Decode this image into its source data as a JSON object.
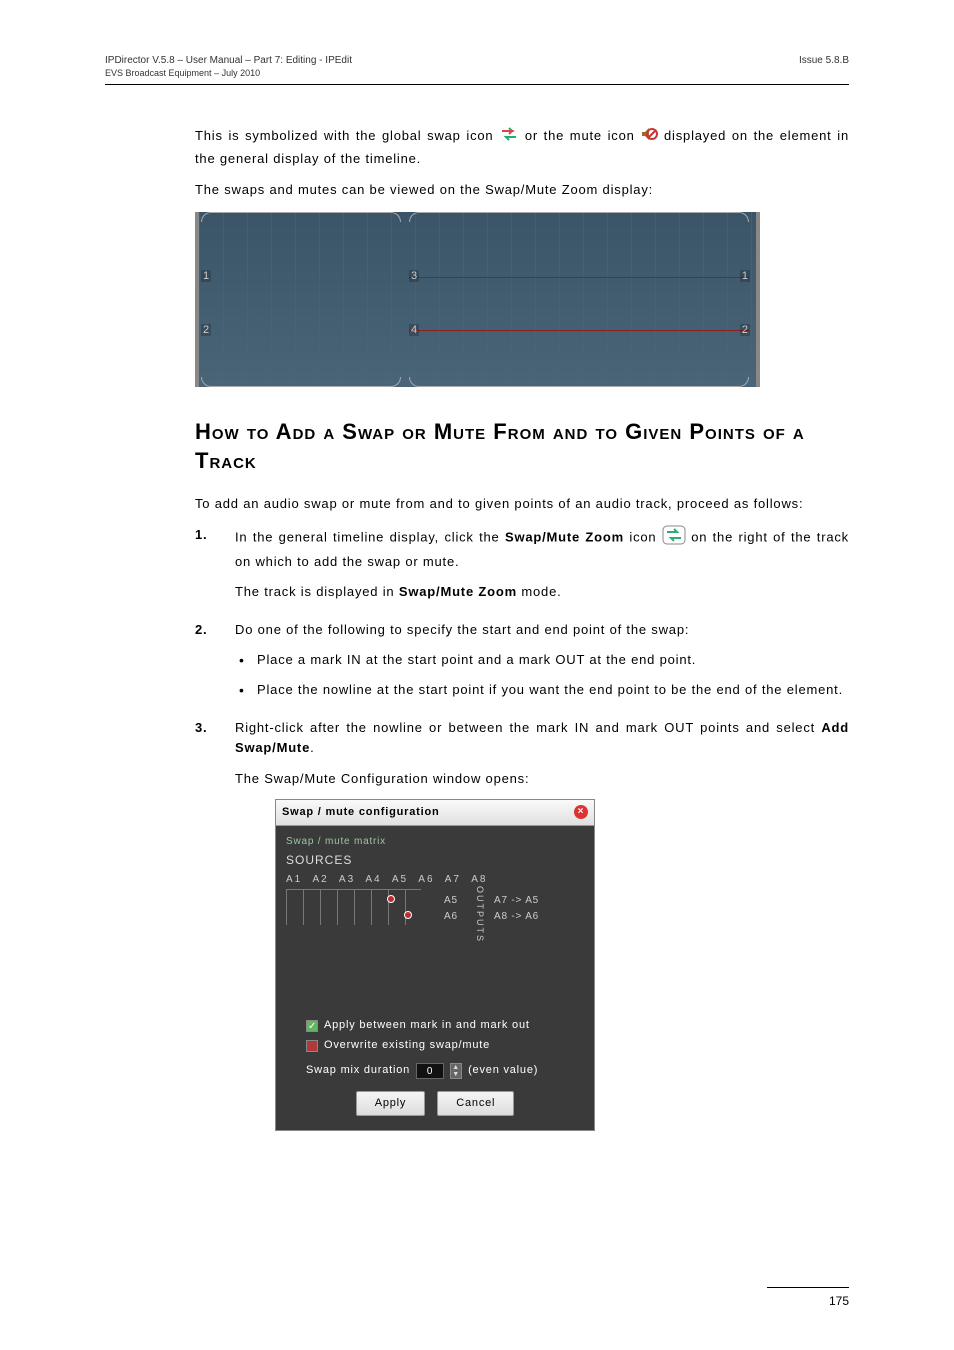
{
  "header": {
    "left": "IPDirector V.5.8 – User Manual – Part 7: Editing - IPEdit",
    "right": "Issue 5.8.B",
    "sub": "EVS Broadcast Equipment – July 2010"
  },
  "intro": {
    "line1_a": "This is symbolized with the global swap icon ",
    "line1_b": " or the mute icon ",
    "line1_c": " displayed on the element in the general display of the timeline.",
    "line2": "The swaps and mutes can be viewed on the Swap/Mute Zoom display:"
  },
  "timeline_labels": {
    "n1": "1",
    "n2": "2",
    "n3": "3",
    "n4": "4"
  },
  "section_title": "How to Add a Swap or Mute From and to Given Points of a Track",
  "para_after_title": "To add an audio swap or mute from and to given points of an audio track, proceed as follows:",
  "steps": {
    "s1_a": "In the general timeline display, click the ",
    "s1_bold": "Swap/Mute Zoom",
    "s1_b": " icon ",
    "s1_c": " on the right of the track on which to add the swap or mute.",
    "s1_sub_a": "The track is displayed in ",
    "s1_sub_bold": "Swap/Mute Zoom",
    "s1_sub_b": " mode.",
    "s2": "Do one of the following to specify the start and end point of the swap:",
    "s2_b1": "Place a mark IN at the start point and a mark OUT at the end point.",
    "s2_b2": "Place the nowline at the start point if you want the end point to be the end of the element.",
    "s3_a": "Right-click after the nowline or between the mark IN and mark OUT points and select ",
    "s3_bold": "Add Swap/Mute",
    "s3_b": ".",
    "s3_sub": "The Swap/Mute Configuration window opens:"
  },
  "dialog": {
    "title": "Swap / mute configuration",
    "fieldset": "Swap / mute matrix",
    "sources": "SOURCES",
    "srcheads": "A1 A2 A3 A4 A5 A6 A7 A8",
    "outputs": "OUTPUTS",
    "out1_l": "A5",
    "out1_r": "A7  -> A5",
    "out2_l": "A6",
    "out2_r": "A8  -> A6",
    "chk1": "Apply between mark in and mark out",
    "chk2": "Overwrite existing swap/mute",
    "dur_label": "Swap mix duration",
    "dur_value": "0",
    "dur_hint": "(even value)",
    "apply": "Apply",
    "cancel": "Cancel"
  },
  "chart_data": {
    "type": "table",
    "title": "Swap / mute matrix",
    "sources": [
      "A1",
      "A2",
      "A3",
      "A4",
      "A5",
      "A6",
      "A7",
      "A8"
    ],
    "outputs": [
      "A5",
      "A6"
    ],
    "mappings": [
      {
        "source": "A7",
        "output": "A5"
      },
      {
        "source": "A8",
        "output": "A6"
      }
    ],
    "apply_between_marks": true,
    "overwrite_existing": false,
    "swap_mix_duration": 0
  },
  "page_number": "175"
}
